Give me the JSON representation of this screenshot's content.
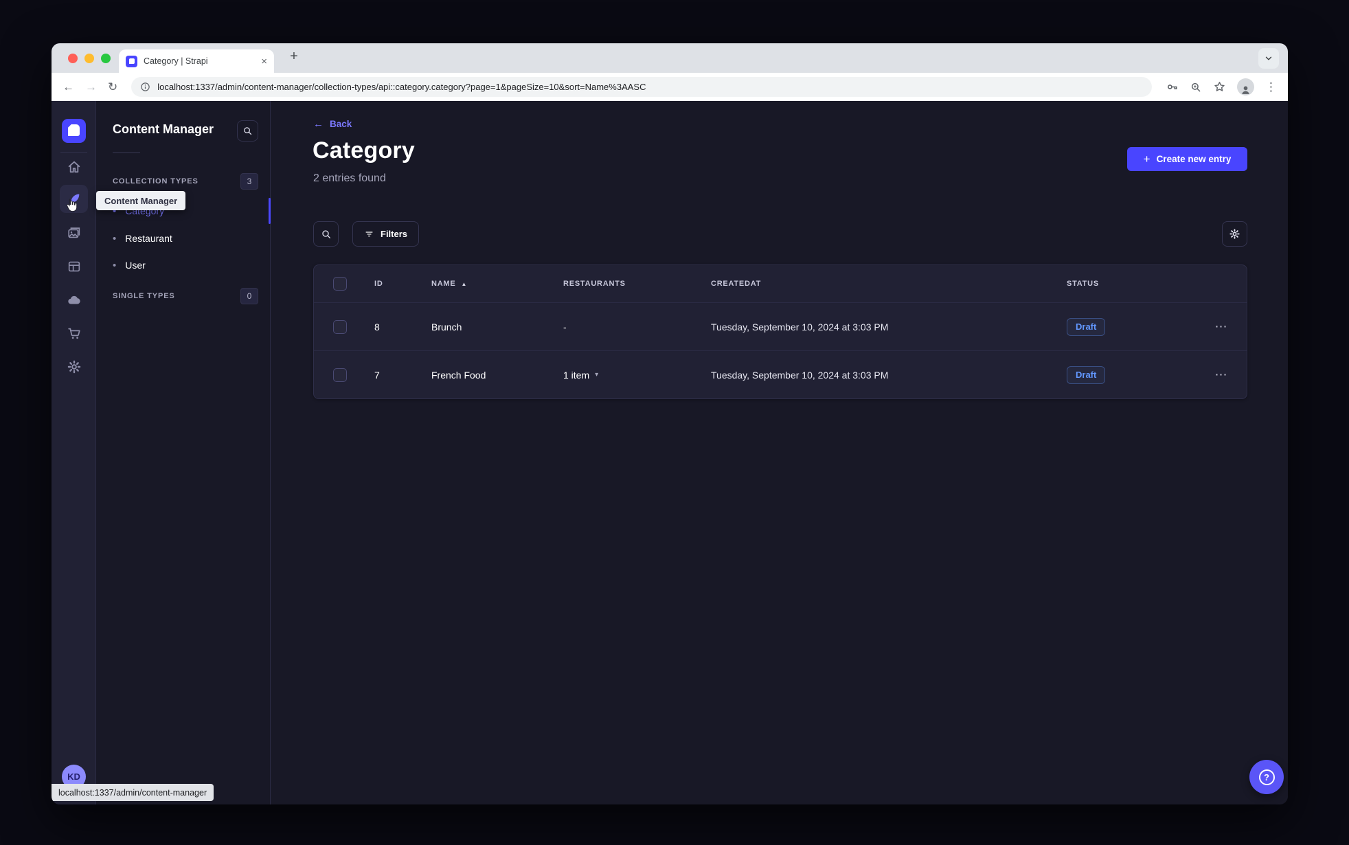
{
  "browser": {
    "tab_title": "Category | Strapi",
    "url": "localhost:1337/admin/content-manager/collection-types/api::category.category?page=1&pageSize=10&sort=Name%3AASC",
    "status_link": "localhost:1337/admin/content-manager",
    "glyphs": {
      "close": "×",
      "new_tab": "+",
      "back": "←",
      "forward": "→",
      "reload": "↻",
      "menu": "⋮"
    }
  },
  "sidebar": {
    "tooltip": "Content Manager",
    "avatar_initials": "KD"
  },
  "subnav": {
    "title": "Content Manager",
    "collection_section": {
      "label": "COLLECTION TYPES",
      "count": "3"
    },
    "collection_items": [
      {
        "label": "Category",
        "bullet": "•"
      },
      {
        "label": "Restaurant",
        "bullet": "•"
      },
      {
        "label": "User",
        "bullet": "•"
      }
    ],
    "single_section": {
      "label": "SINGLE TYPES",
      "count": "0"
    }
  },
  "main": {
    "back_glyph": "←",
    "back_label": "Back",
    "title": "Category",
    "subtitle": "2 entries found",
    "create_plus": "+",
    "create_button": "Create new entry",
    "filters_button": "Filters"
  },
  "table": {
    "headers": {
      "id": "ID",
      "name": "NAME",
      "restaurants": "RESTAURANTS",
      "createdat": "CREATEDAT",
      "status": "STATUS"
    },
    "sort_glyph": "▲",
    "caret_glyph": "▾",
    "menu_glyph": "⋯",
    "rows": [
      {
        "id": "8",
        "name": "Brunch",
        "restaurants": "-",
        "has_items": false,
        "createdat": "Tuesday, September 10, 2024 at 3:03 PM",
        "status": "Draft"
      },
      {
        "id": "7",
        "name": "French Food",
        "restaurants": "1 item",
        "has_items": true,
        "createdat": "Tuesday, September 10, 2024 at 3:03 PM",
        "status": "Draft"
      }
    ]
  },
  "fab": {
    "help": "?"
  },
  "colors": {
    "accent": "#4945ff",
    "link": "#7b79ff",
    "draft": "#6297ff",
    "app_bg": "#181826",
    "surface": "#212134"
  }
}
